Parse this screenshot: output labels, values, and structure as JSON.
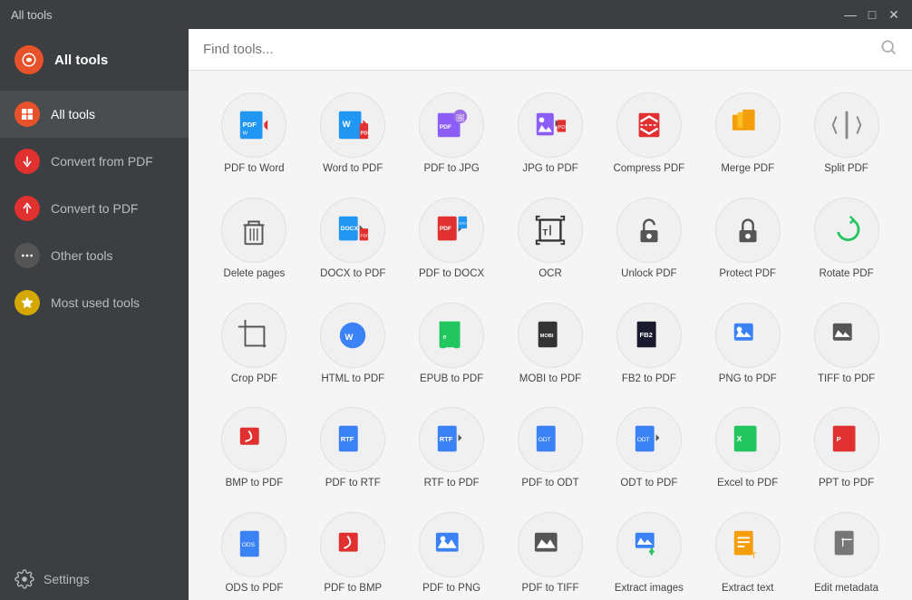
{
  "titleBar": {
    "title": "All tools",
    "minimize": "—",
    "restore": "□",
    "close": "✕"
  },
  "sidebar": {
    "logo": {
      "label": "All tools"
    },
    "navItems": [
      {
        "id": "all-tools",
        "label": "All tools",
        "iconType": "orange",
        "active": true
      },
      {
        "id": "convert-from-pdf",
        "label": "Convert from PDF",
        "iconType": "red",
        "active": false
      },
      {
        "id": "convert-to-pdf",
        "label": "Convert to PDF",
        "iconType": "red",
        "active": false
      },
      {
        "id": "other-tools",
        "label": "Other tools",
        "iconType": "gray",
        "active": false
      },
      {
        "id": "most-used-tools",
        "label": "Most used tools",
        "iconType": "yellow",
        "active": false
      }
    ],
    "settings": "Settings"
  },
  "searchBar": {
    "placeholder": "Find tools..."
  },
  "tools": [
    {
      "id": "pdf-to-word",
      "label": "PDF to Word",
      "iconColor": "#2196f3",
      "iconType": "pdf-to-word"
    },
    {
      "id": "word-to-pdf",
      "label": "Word to PDF",
      "iconColor": "#2196f3",
      "iconType": "word-to-pdf"
    },
    {
      "id": "pdf-to-jpg",
      "label": "PDF to JPG",
      "iconColor": "#8b5cf6",
      "iconType": "pdf-to-jpg"
    },
    {
      "id": "jpg-to-pdf",
      "label": "JPG to PDF",
      "iconColor": "#8b5cf6",
      "iconType": "jpg-to-pdf"
    },
    {
      "id": "compress-pdf",
      "label": "Compress PDF",
      "iconColor": "#e03030",
      "iconType": "compress-pdf"
    },
    {
      "id": "merge-pdf",
      "label": "Merge PDF",
      "iconColor": "#f59e0b",
      "iconType": "merge-pdf"
    },
    {
      "id": "split-pdf",
      "label": "Split PDF",
      "iconColor": "#9ca3af",
      "iconType": "split-pdf"
    },
    {
      "id": "delete-pages",
      "label": "Delete pages",
      "iconColor": "#555",
      "iconType": "delete-pages"
    },
    {
      "id": "docx-to-pdf",
      "label": "DOCX to PDF",
      "iconColor": "#2196f3",
      "iconType": "docx-to-pdf"
    },
    {
      "id": "pdf-to-docx",
      "label": "PDF to DOCX",
      "iconColor": "#2196f3",
      "iconType": "pdf-to-docx"
    },
    {
      "id": "ocr",
      "label": "OCR",
      "iconColor": "#333",
      "iconType": "ocr"
    },
    {
      "id": "unlock-pdf",
      "label": "Unlock PDF",
      "iconColor": "#555",
      "iconType": "unlock-pdf"
    },
    {
      "id": "protect-pdf",
      "label": "Protect PDF",
      "iconColor": "#555",
      "iconType": "protect-pdf"
    },
    {
      "id": "rotate-pdf",
      "label": "Rotate PDF",
      "iconColor": "#22c55e",
      "iconType": "rotate-pdf"
    },
    {
      "id": "crop-pdf",
      "label": "Crop PDF",
      "iconColor": "#555",
      "iconType": "crop-pdf"
    },
    {
      "id": "html-to-pdf",
      "label": "HTML to PDF",
      "iconColor": "#3b82f6",
      "iconType": "html-to-pdf"
    },
    {
      "id": "epub-to-pdf",
      "label": "EPUB to PDF",
      "iconColor": "#22c55e",
      "iconType": "epub-to-pdf"
    },
    {
      "id": "mobi-to-pdf",
      "label": "MOBI to PDF",
      "iconColor": "#333",
      "iconType": "mobi-to-pdf"
    },
    {
      "id": "fb2-to-pdf",
      "label": "FB2 to PDF",
      "iconColor": "#333",
      "iconType": "fb2-to-pdf"
    },
    {
      "id": "png-to-pdf",
      "label": "PNG to PDF",
      "iconColor": "#3b82f6",
      "iconType": "png-to-pdf"
    },
    {
      "id": "tiff-to-pdf",
      "label": "TIFF to PDF",
      "iconColor": "#555",
      "iconType": "tiff-to-pdf"
    },
    {
      "id": "bmp-to-pdf",
      "label": "BMP to PDF",
      "iconColor": "#e03030",
      "iconType": "bmp-to-pdf"
    },
    {
      "id": "pdf-to-rtf",
      "label": "PDF to RTF",
      "iconColor": "#3b82f6",
      "iconType": "pdf-to-rtf"
    },
    {
      "id": "rtf-to-pdf",
      "label": "RTF to PDF",
      "iconColor": "#3b82f6",
      "iconType": "rtf-to-pdf"
    },
    {
      "id": "pdf-to-odt",
      "label": "PDF to ODT",
      "iconColor": "#3b82f6",
      "iconType": "pdf-to-odt"
    },
    {
      "id": "odt-to-pdf",
      "label": "ODT to PDF",
      "iconColor": "#3b82f6",
      "iconType": "odt-to-pdf"
    },
    {
      "id": "excel-to-pdf",
      "label": "Excel to PDF",
      "iconColor": "#22c55e",
      "iconType": "excel-to-pdf"
    },
    {
      "id": "ppt-to-pdf",
      "label": "PPT to PDF",
      "iconColor": "#e03030",
      "iconType": "ppt-to-pdf"
    },
    {
      "id": "ods-to-pdf",
      "label": "ODS to PDF",
      "iconColor": "#3b82f6",
      "iconType": "ods-to-pdf"
    },
    {
      "id": "pdf-to-bmp",
      "label": "PDF to BMP",
      "iconColor": "#e03030",
      "iconType": "pdf-to-bmp"
    },
    {
      "id": "pdf-to-png",
      "label": "PDF to PNG",
      "iconColor": "#3b82f6",
      "iconType": "pdf-to-png"
    },
    {
      "id": "pdf-to-tiff",
      "label": "PDF to TIFF",
      "iconColor": "#555",
      "iconType": "pdf-to-tiff"
    },
    {
      "id": "extract-images",
      "label": "Extract images",
      "iconColor": "#3b82f6",
      "iconType": "extract-images"
    },
    {
      "id": "extract-text",
      "label": "Extract text",
      "iconColor": "#f59e0b",
      "iconType": "extract-text"
    },
    {
      "id": "edit-metadata",
      "label": "Edit metadata",
      "iconColor": "#555",
      "iconType": "edit-metadata"
    }
  ]
}
